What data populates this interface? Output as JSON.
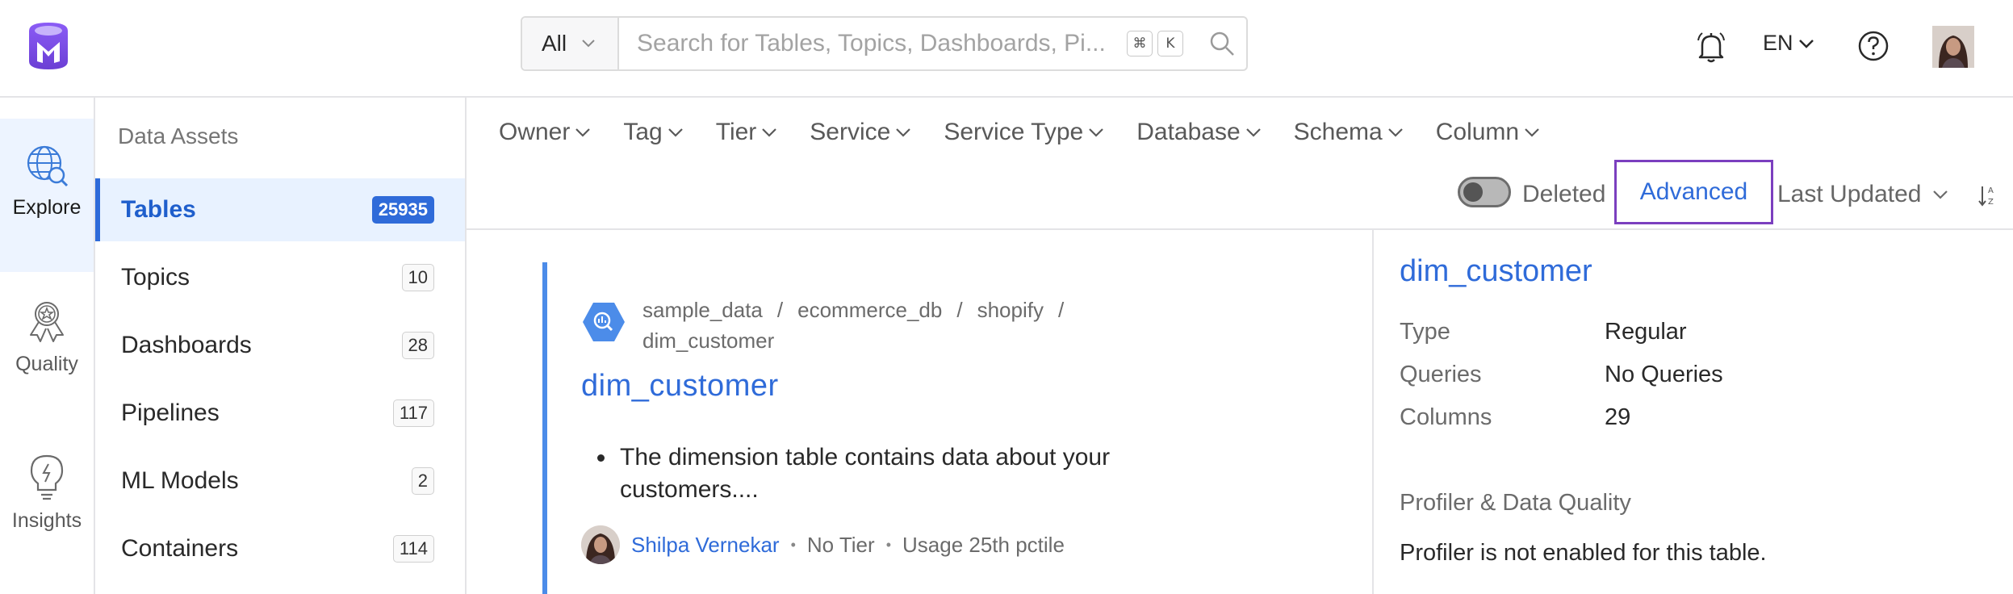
{
  "header": {
    "search_scope": "All",
    "search_placeholder": "Search for Tables, Topics, Dashboards, Pi...",
    "shortcut_keys": [
      "⌘",
      "K"
    ],
    "language": "EN"
  },
  "nav": {
    "items": [
      {
        "label": "Explore",
        "icon": "explore-icon",
        "active": true
      },
      {
        "label": "Quality",
        "icon": "quality-icon",
        "active": false
      },
      {
        "label": "Insights",
        "icon": "insights-icon",
        "active": false
      }
    ]
  },
  "assets": {
    "title": "Data Assets",
    "items": [
      {
        "label": "Tables",
        "count": "25935",
        "active": true
      },
      {
        "label": "Topics",
        "count": "10",
        "active": false
      },
      {
        "label": "Dashboards",
        "count": "28",
        "active": false
      },
      {
        "label": "Pipelines",
        "count": "117",
        "active": false
      },
      {
        "label": "ML Models",
        "count": "2",
        "active": false
      },
      {
        "label": "Containers",
        "count": "114",
        "active": false
      }
    ]
  },
  "filters": {
    "items": [
      "Owner",
      "Tag",
      "Tier",
      "Service",
      "Service Type",
      "Database",
      "Schema",
      "Column"
    ],
    "deleted_label": "Deleted",
    "deleted_on": false,
    "advanced_label": "Advanced",
    "sort_label": "Last Updated"
  },
  "result": {
    "breadcrumb": [
      "sample_data",
      "ecommerce_db",
      "shopify",
      "dim_customer"
    ],
    "title": "dim_customer",
    "description": "The dimension table contains data about your customers....",
    "owner": "Shilpa Vernekar",
    "tier": "No Tier",
    "usage": "Usage 25th pctile"
  },
  "summary": {
    "title": "dim_customer",
    "rows": [
      {
        "key": "Type",
        "value": "Regular"
      },
      {
        "key": "Queries",
        "value": "No Queries"
      },
      {
        "key": "Columns",
        "value": "29"
      }
    ],
    "section_title": "Profiler & Data Quality",
    "profiler_note": "Profiler is not enabled for this table."
  },
  "colors": {
    "accent": "#2f6bd9",
    "brand": "#7147e8",
    "advanced_border": "#7b3fbf",
    "active_bg": "#e8f2ff"
  }
}
